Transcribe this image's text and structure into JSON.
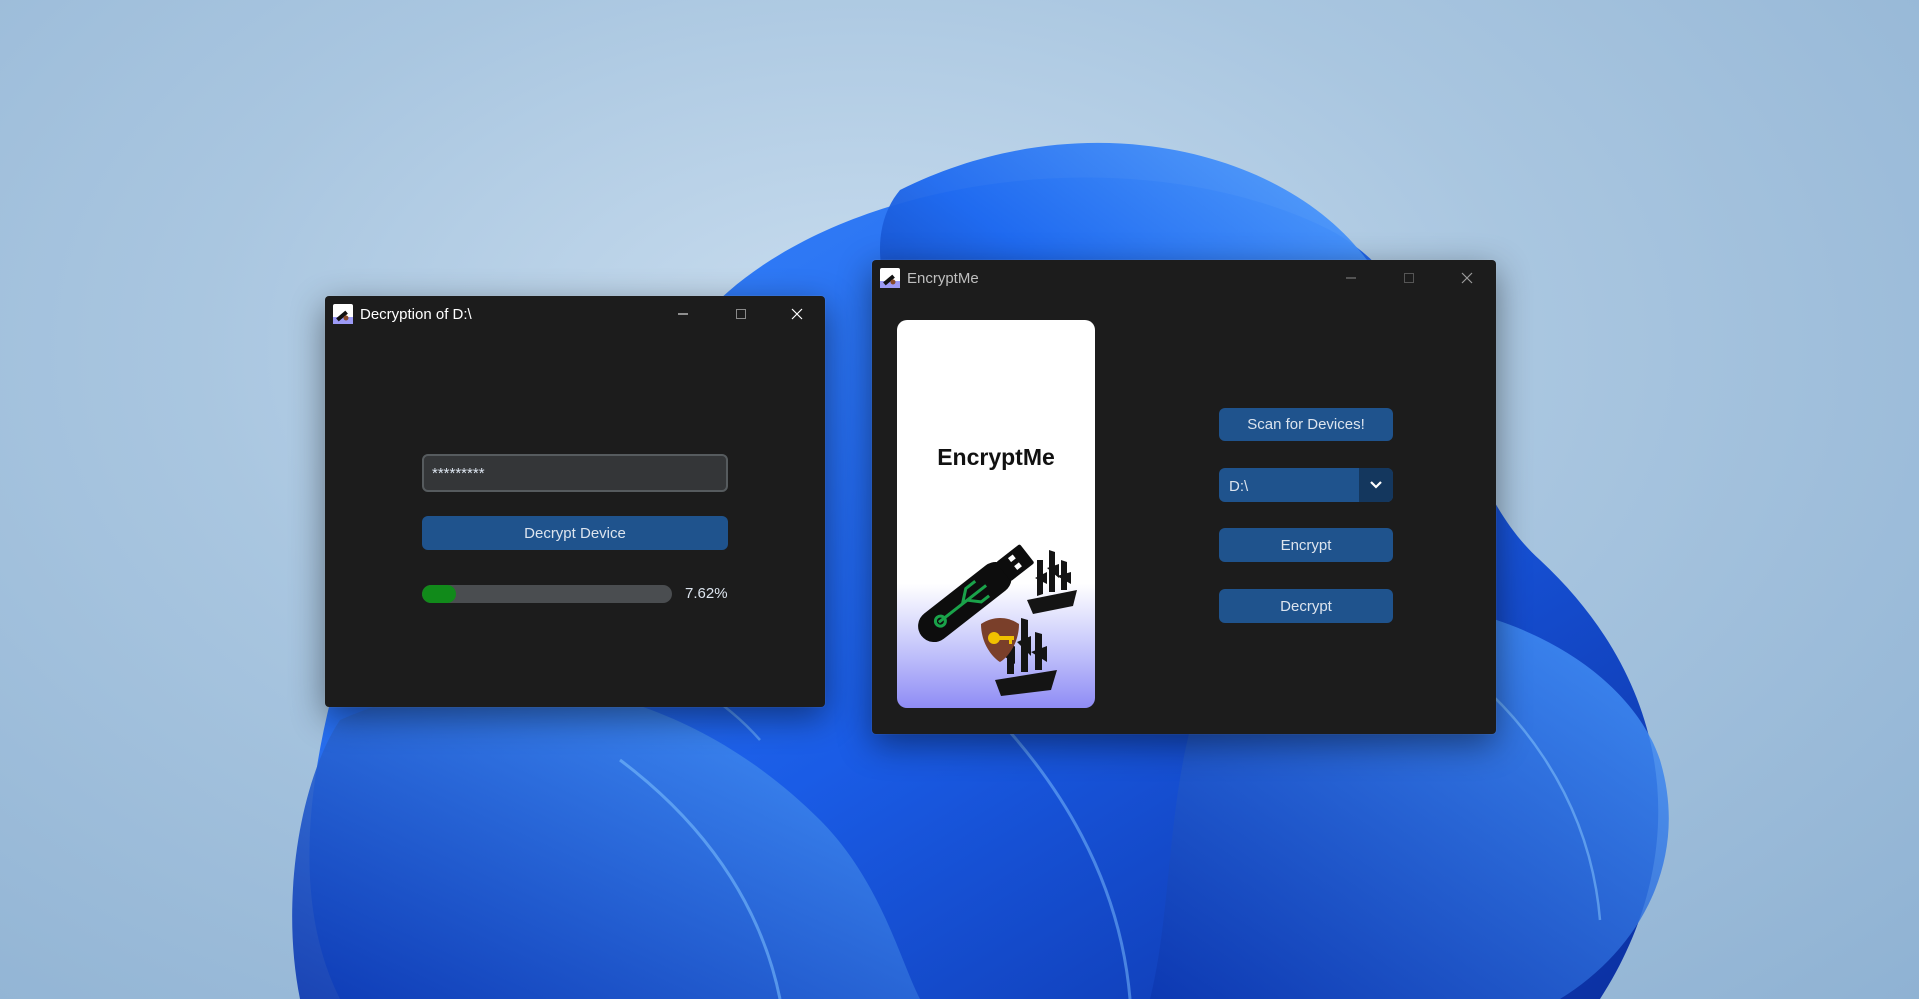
{
  "decrypt_window": {
    "title": "Decryption of D:\\",
    "password_value": "*********",
    "decrypt_button_label": "Decrypt Device",
    "progress_value": 0.0762,
    "progress_text": "7.62%"
  },
  "main_window": {
    "title": "EncryptMe",
    "logo_text": "EncryptMe",
    "scan_button_label": "Scan for Devices!",
    "device_select_value": "D:\\",
    "encrypt_button_label": "Encrypt",
    "decrypt_button_label": "Decrypt"
  },
  "icons": {
    "app_icon": "encryptme-app-icon",
    "minimize": "minimize-icon",
    "maximize": "maximize-icon",
    "close": "close-icon",
    "dropdown": "chevron-down-icon",
    "logo": "usb-drive-shield-key-ships-logo"
  },
  "colors": {
    "window_bg": "#1c1c1c",
    "button": "#1f538d",
    "button_dark": "#14375e",
    "progress_fill": "#118a1a",
    "progress_track": "#4a4d50"
  }
}
